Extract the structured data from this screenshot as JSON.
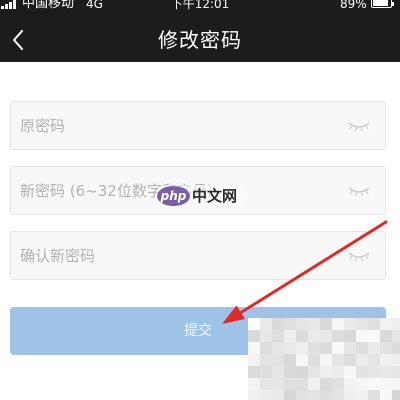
{
  "status_bar": {
    "carrier": "中国移动",
    "network": "4G",
    "time": "下午12:01",
    "battery": "89%",
    "icons": {
      "signal": "signal-icon",
      "battery": "battery-icon"
    }
  },
  "nav": {
    "title": "修改密码",
    "back_icon": "chevron-left-icon"
  },
  "form": {
    "fields": [
      {
        "placeholder": "原密码",
        "icon": "eye-closed-icon"
      },
      {
        "placeholder": "新密码 (6~32位数字和字母)",
        "icon": "eye-closed-icon"
      },
      {
        "placeholder": "确认新密码",
        "icon": "eye-closed-icon"
      }
    ],
    "submit_label": "提交"
  },
  "watermark": {
    "logo": "php",
    "text": "中文网"
  },
  "colors": {
    "header_bg": "#1c1c1c",
    "submit_bg": "#9ec3e7",
    "arrow": "#e02a2a"
  }
}
